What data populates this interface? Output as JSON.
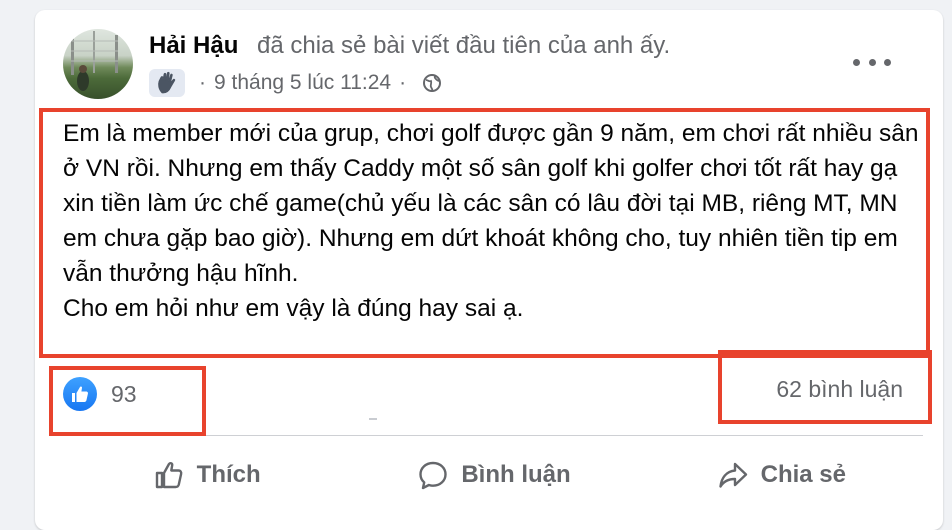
{
  "post": {
    "author": "Hải Hậu",
    "action_text": "đã chia sẻ bài viết đầu tiên của anh ấy.",
    "badge_icon": "waving-hand-icon",
    "timestamp": "9 tháng 5 lúc 11:24",
    "separator": "·",
    "privacy_icon": "globe-icon",
    "menu_icon": "more-options-icon",
    "paragraphs": [
      "Em là member mới của grup, chơi golf được gần 9 năm, em chơi rất nhiều sân ở VN rồi. Nhưng em thấy Caddy một số sân golf khi golfer chơi tốt rất hay gạ xin tiền làm ức chế game(chủ yếu là các sân có lâu đời tại MB, riêng MT, MN em chưa gặp bao giờ). Nhưng em dứt khoát không cho, tuy nhiên tiền tip em vẫn thưởng hậu hĩnh.",
      "Cho em hỏi như em vậy là đúng hay sai ạ."
    ]
  },
  "stats": {
    "reaction_icon": "thumbs-up-icon",
    "likes": "93",
    "comments": "62 bình luận"
  },
  "actions": {
    "like": "Thích",
    "comment": "Bình luận",
    "share": "Chia sẻ"
  },
  "colors": {
    "highlight": "#e8432d",
    "like_blue": "#1877f2",
    "muted_text": "#65676b"
  }
}
